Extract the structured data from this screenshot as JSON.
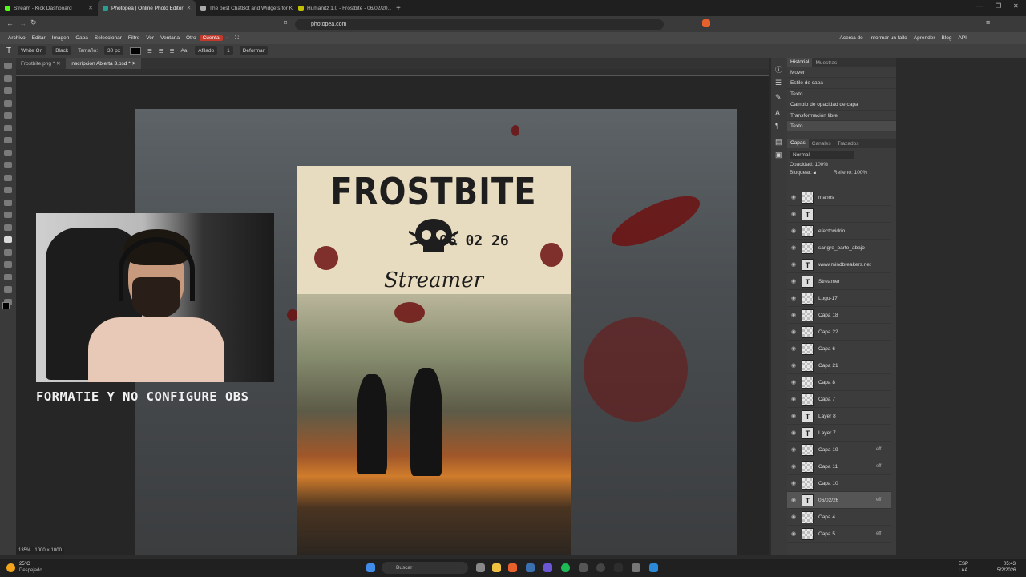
{
  "browser": {
    "tabs": [
      {
        "label": "Stream - Kick Dashboard",
        "color": "#53fc18",
        "active": false
      },
      {
        "label": "Photopea | Online Photo Editor",
        "color": "#2a9d8f",
        "active": true
      },
      {
        "label": "The best ChatBot and Widgets for K...",
        "color": "#aaaaaa",
        "active": false
      },
      {
        "label": "Humanitz 1.0 - Frostbite - 06/02/20...",
        "color": "#c0c000",
        "active": false
      }
    ],
    "new_tab": "+",
    "url": "photopea.com"
  },
  "menu": {
    "items": [
      "Archivo",
      "Editar",
      "Imagen",
      "Capa",
      "Seleccionar",
      "Filtro",
      "Ver",
      "Ventana",
      "Otro"
    ],
    "account": "Cuenta",
    "right_links": [
      "Acerca de",
      "Informar un fallo",
      "Aprender",
      "Blog",
      "API"
    ]
  },
  "options": {
    "font": "White On",
    "style": "Black",
    "size_label": "Tamaño:",
    "size": "30 px",
    "aa_label": "Aa:",
    "aa_value": "Afilado",
    "leading": "1",
    "warp": "Deformar"
  },
  "documents": [
    {
      "label": "Frostbite.png *",
      "active": false
    },
    {
      "label": "Inscripcion Abierta 3.psd *",
      "active": true
    }
  ],
  "canvas": {
    "poster_title": "FROSTBITE",
    "poster_date": "06 02 26",
    "poster_subtitle": "Streamer"
  },
  "webcam_caption": "FORMATIE Y NO CONFIGURE OBS",
  "history": {
    "tabs": [
      "Historial",
      "Muestras"
    ],
    "items": [
      "Mover",
      "Estilo de capa",
      "Texto",
      "Cambio de opacidad de capa",
      "Transformación libre",
      "Texto"
    ]
  },
  "layers_panel": {
    "tabs": [
      "Capas",
      "Canales",
      "Trazados"
    ],
    "blend_mode": "Normal",
    "opacity_label": "Opacidad:",
    "opacity": "100%",
    "lock_label": "Bloquear:",
    "fill_label": "Relleno:",
    "fill": "100%",
    "layers": [
      {
        "name": "manos",
        "type": "image",
        "fx": ""
      },
      {
        "name": "",
        "type": "text",
        "fx": ""
      },
      {
        "name": "efectovidrio",
        "type": "image",
        "fx": ""
      },
      {
        "name": "sangre_parte_abajo",
        "type": "image",
        "fx": ""
      },
      {
        "name": "www.mindbreakers.net",
        "type": "text",
        "fx": ""
      },
      {
        "name": "Streamer",
        "type": "text",
        "fx": ""
      },
      {
        "name": "Logo-17",
        "type": "image",
        "fx": ""
      },
      {
        "name": "Capa 18",
        "type": "image",
        "fx": ""
      },
      {
        "name": "Capa 22",
        "type": "image",
        "fx": ""
      },
      {
        "name": "Capa 6",
        "type": "image",
        "fx": ""
      },
      {
        "name": "Capa 21",
        "type": "image",
        "fx": ""
      },
      {
        "name": "Capa 8",
        "type": "image",
        "fx": ""
      },
      {
        "name": "Capa 7",
        "type": "image",
        "fx": ""
      },
      {
        "name": "Layer 8",
        "type": "text",
        "fx": ""
      },
      {
        "name": "Layer 7",
        "type": "text",
        "fx": ""
      },
      {
        "name": "Capa 19",
        "type": "image",
        "fx": "eff"
      },
      {
        "name": "Capa 11",
        "type": "image",
        "fx": "eff"
      },
      {
        "name": "Capa 10",
        "type": "image",
        "fx": ""
      },
      {
        "name": "06/02/26",
        "type": "text",
        "fx": "eff"
      },
      {
        "name": "Capa 4",
        "type": "image",
        "fx": ""
      },
      {
        "name": "Capa 5",
        "type": "image",
        "fx": "eff"
      }
    ]
  },
  "status": {
    "zoom": "135%",
    "dimensions": "1000 × 1000"
  },
  "taskbar": {
    "weather_temp": "25°C",
    "weather_text": "Despejado",
    "search": "Buscar",
    "lang": "ESP",
    "lang2": "LAA",
    "time": "05:43",
    "date": "5/2/2026"
  }
}
